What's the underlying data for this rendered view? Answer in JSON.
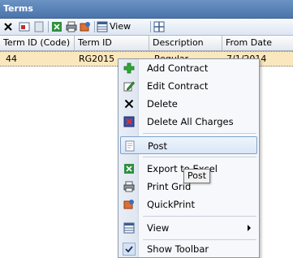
{
  "panel": {
    "title": "Terms"
  },
  "toolbar": {
    "view_label": "View"
  },
  "grid": {
    "columns": [
      "Term ID (Code)",
      "Term ID",
      "Description",
      "From Date"
    ],
    "rows": [
      {
        "term_code": "44",
        "term_id": "RG2015",
        "description": "Regular",
        "from_date": "7/1/2014"
      }
    ]
  },
  "context_menu": {
    "items": [
      {
        "label": "Add Contract",
        "icon": "add-icon"
      },
      {
        "label": "Edit Contract",
        "icon": "edit-pencil-icon"
      },
      {
        "label": "Delete",
        "icon": "delete-x-icon"
      },
      {
        "label": "Delete All Charges",
        "icon": "delete-all-icon"
      },
      {
        "label": "Post",
        "icon": "post-document-icon",
        "highlighted": true
      },
      {
        "label": "Export to Excel",
        "icon": "excel-icon"
      },
      {
        "label": "Print Grid",
        "icon": "printer-icon"
      },
      {
        "label": "QuickPrint",
        "icon": "quickprint-icon"
      },
      {
        "label": "View",
        "icon": "view-icon",
        "has_submenu": true
      },
      {
        "label": "Show Toolbar",
        "icon": "checkmark-icon",
        "checked": true
      }
    ]
  },
  "tooltip": {
    "text": "Post"
  },
  "colors": {
    "row_highlight": "#fbe7bd",
    "title_bar": "#5a82b8",
    "menu_hover_border": "#7da2ce"
  }
}
